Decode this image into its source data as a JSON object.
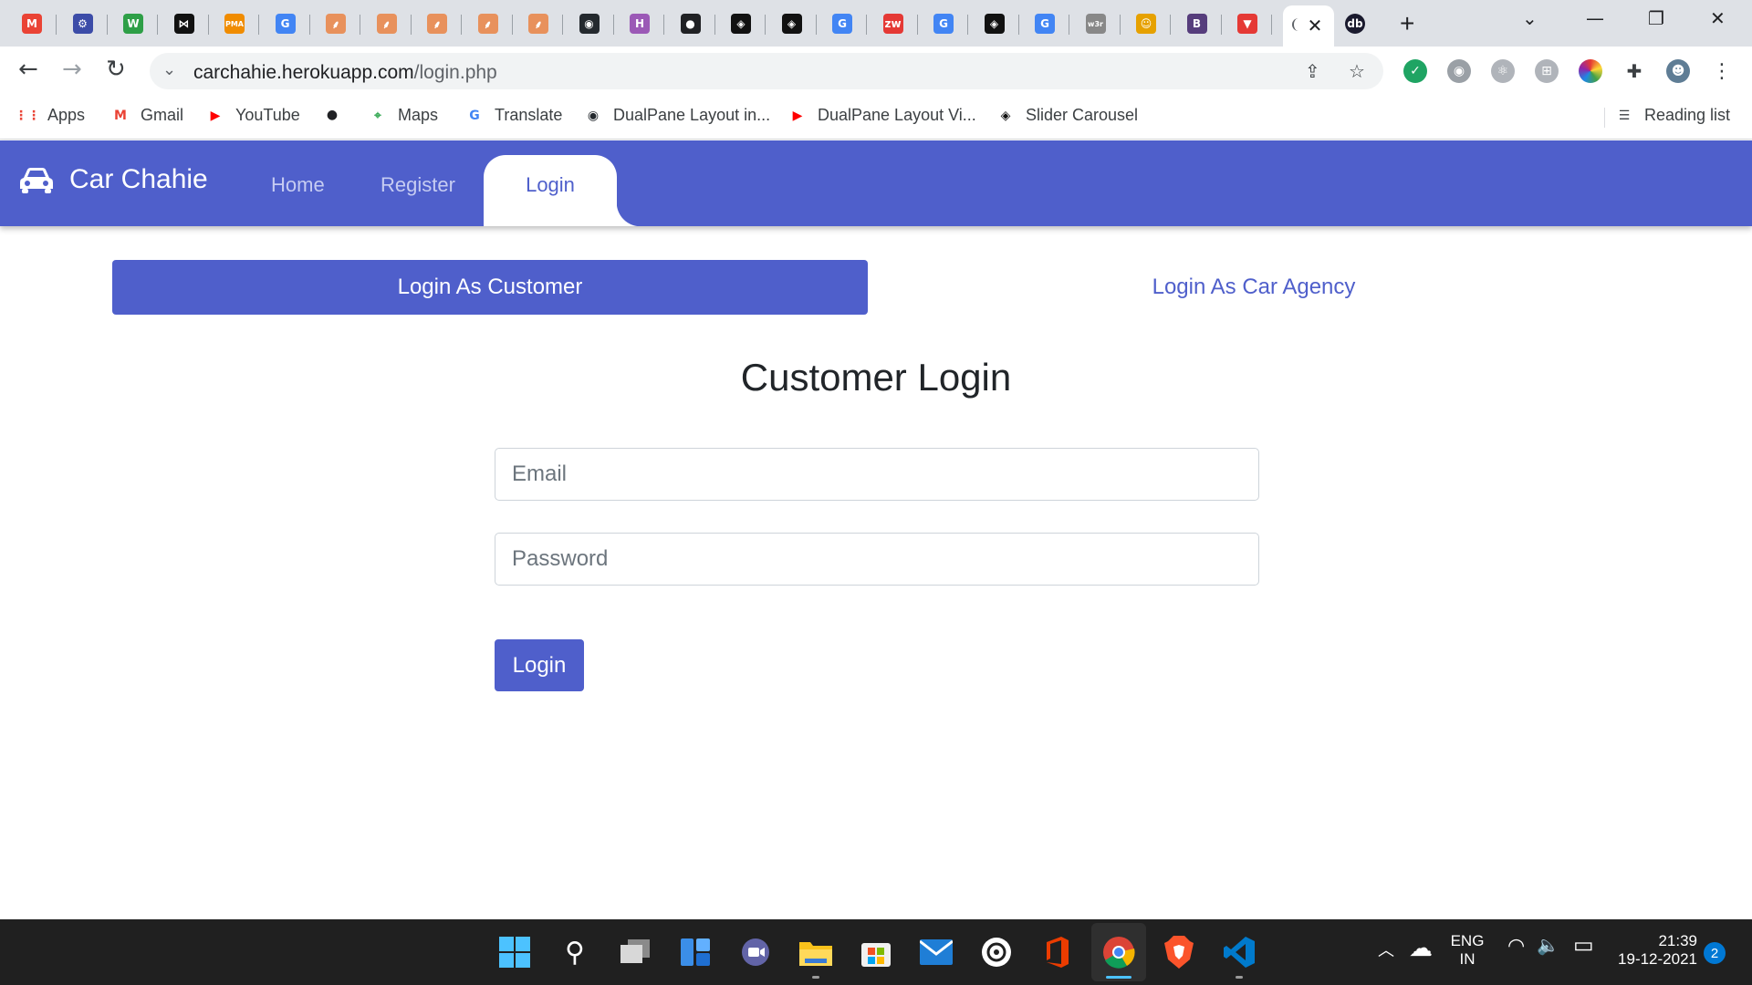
{
  "browser": {
    "url_host": "carchahie.herokuapp.com",
    "url_path": "/login.php",
    "close_tab_glyph": "✕",
    "new_tab_glyph": "+",
    "tab_list_glyph": "⌄",
    "minimize_glyph": "—",
    "restore_glyph": "❐",
    "close_window_glyph": "✕",
    "tabs": [
      {
        "icon": "gmail-icon",
        "label": "M",
        "color": "#ea4335"
      },
      {
        "icon": "gear-site-icon",
        "label": "⚙",
        "color": "#3c4ca8"
      },
      {
        "icon": "w3-icon",
        "label": "W",
        "color": "#2e9f47"
      },
      {
        "icon": "bowtie-icon",
        "label": "⋈",
        "color": "#111111"
      },
      {
        "icon": "pma-icon",
        "label": "PMA",
        "color": "#f08c00"
      },
      {
        "icon": "google-icon",
        "label": "G",
        "color": "#4285f4"
      },
      {
        "icon": "feather-icon",
        "label": "⸙",
        "color": "#e8915c"
      },
      {
        "icon": "feather-icon",
        "label": "⸙",
        "color": "#e8915c"
      },
      {
        "icon": "feather-icon",
        "label": "⸙",
        "color": "#e8915c"
      },
      {
        "icon": "feather-icon",
        "label": "⸙",
        "color": "#e8915c"
      },
      {
        "icon": "feather-icon",
        "label": "⸙",
        "color": "#e8915c"
      },
      {
        "icon": "github-icon",
        "label": "◉",
        "color": "#24292e"
      },
      {
        "icon": "h-icon",
        "label": "H",
        "color": "#9b59b6"
      },
      {
        "icon": "globe-icon",
        "label": "●",
        "color": "#202124"
      },
      {
        "icon": "codepen-icon",
        "label": "◈",
        "color": "#111111"
      },
      {
        "icon": "codepen-icon",
        "label": "◈",
        "color": "#111111"
      },
      {
        "icon": "google-icon",
        "label": "G",
        "color": "#4285f4"
      },
      {
        "icon": "zw-icon",
        "label": "zw",
        "color": "#e53935"
      },
      {
        "icon": "google-icon",
        "label": "G",
        "color": "#4285f4"
      },
      {
        "icon": "codepen-icon",
        "label": "◈",
        "color": "#111111"
      },
      {
        "icon": "google-icon",
        "label": "G",
        "color": "#4285f4"
      },
      {
        "icon": "w3r-icon",
        "label": "w3r",
        "color": "#888888"
      },
      {
        "icon": "cartoon-icon",
        "label": "☺",
        "color": "#e6a100"
      },
      {
        "icon": "bootstrap-icon",
        "label": "B",
        "color": "#563d7c"
      },
      {
        "icon": "vivaldi-icon",
        "label": "▼",
        "color": "#e53935"
      }
    ],
    "active_tab_icon": "loading-icon",
    "after_tab": {
      "icon": "db-icon",
      "label": "db",
      "color": "#1a1a2e"
    }
  },
  "bookmarks": [
    {
      "icon": "apps-grid-icon",
      "label": "Apps",
      "glyph": "⋮⋮",
      "color": "#ea4335"
    },
    {
      "icon": "gmail-icon",
      "label": "Gmail",
      "glyph": "M",
      "color": "#ea4335"
    },
    {
      "icon": "youtube-icon",
      "label": "YouTube",
      "glyph": "▶",
      "color": "#ff0000"
    },
    {
      "icon": "globe-icon",
      "label": "",
      "glyph": "●",
      "color": "#202124"
    },
    {
      "icon": "maps-icon",
      "label": "Maps",
      "glyph": "⌖",
      "color": "#34a853"
    },
    {
      "icon": "translate-icon",
      "label": "Translate",
      "glyph": "G",
      "color": "#4285f4"
    },
    {
      "icon": "github-icon",
      "label": "DualPane Layout in...",
      "glyph": "◉",
      "color": "#24292e"
    },
    {
      "icon": "youtube-icon",
      "label": "DualPane Layout Vi...",
      "glyph": "▶",
      "color": "#ff0000"
    },
    {
      "icon": "codepen-icon",
      "label": "Slider Carousel",
      "glyph": "◈",
      "color": "#111111"
    }
  ],
  "reading_list": {
    "label": "Reading list",
    "glyph": "☰"
  },
  "site": {
    "brand": "Car Chahie",
    "nav": {
      "home": "Home",
      "register": "Register",
      "login": "Login"
    },
    "tab_customer": "Login As Customer",
    "tab_agency": "Login As Car Agency",
    "heading": "Customer Login",
    "email_placeholder": "Email",
    "password_placeholder": "Password",
    "submit": "Login",
    "accent_color": "#4f5fcb"
  },
  "taskbar": {
    "language_top": "ENG",
    "language_bottom": "IN",
    "time": "21:39",
    "date": "19-12-2021",
    "notifications": "2",
    "tray_up_glyph": "︿",
    "cloud_glyph": "☁",
    "wifi_glyph": "◠",
    "volume_glyph": "🔈",
    "battery_glyph": "▭"
  }
}
